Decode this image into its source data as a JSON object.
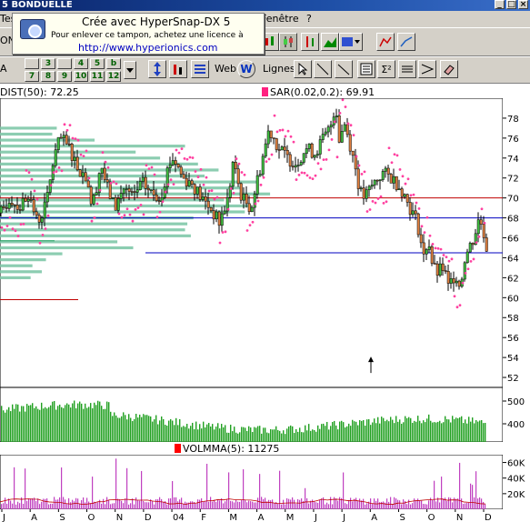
{
  "window": {
    "title": "5 BONDUELLE"
  },
  "menu": {
    "left_fragment": "Tes",
    "window_menu": "Fenêtre",
    "help_menu": "?"
  },
  "toolbar": {
    "left_fragment1": "ON",
    "left_fragment2": "A",
    "numbers_row1": [
      "3",
      "4",
      "5",
      "6"
    ],
    "numbers_row2": [
      "7",
      "8",
      "9",
      "10",
      "11",
      "12"
    ],
    "letters": [
      "a",
      "b"
    ],
    "web_label": "Web",
    "lines_label": "Lignes"
  },
  "stamp": {
    "line1": "Crée avec HyperSnap-DX 5",
    "line2": "Pour enlever ce tampon, achetez une licence à",
    "line3": "http://www.hyperionics.com"
  },
  "indicators": {
    "dist": "DIST(50): 72.25",
    "sar": "SAR(0.02,0.2): 69.91",
    "volmma": "VOLMMA(5): 11275",
    "dist_color": "#ff0000",
    "sar_color": "#ff2080"
  },
  "chart_data": [
    {
      "type": "candlestick",
      "ylim": [
        51,
        80
      ],
      "yticks": [
        "52",
        "54",
        "56",
        "58",
        "60",
        "62",
        "64",
        "66",
        "68",
        "70",
        "72",
        "74",
        "76",
        "78"
      ],
      "xlabels": [
        "J",
        "A",
        "S",
        "O",
        "N",
        "D",
        "04",
        "F",
        "M",
        "A",
        "M",
        "J",
        "J",
        "A",
        "S",
        "O",
        "N",
        "D"
      ],
      "price_path": [
        [
          0,
          68.5
        ],
        [
          10,
          70.0
        ],
        [
          20,
          69.0
        ],
        [
          30,
          70.5
        ],
        [
          40,
          67.5
        ],
        [
          50,
          69.5
        ],
        [
          58,
          74.0
        ],
        [
          65,
          76.0
        ],
        [
          75,
          75.0
        ],
        [
          85,
          73.0
        ],
        [
          95,
          72.0
        ],
        [
          100,
          69.0
        ],
        [
          110,
          73.5
        ],
        [
          115,
          71.5
        ],
        [
          125,
          69.0
        ],
        [
          135,
          71.0
        ],
        [
          145,
          70.0
        ],
        [
          155,
          71.5
        ],
        [
          165,
          70.5
        ],
        [
          175,
          70.0
        ],
        [
          185,
          73.5
        ],
        [
          190,
          74.0
        ],
        [
          200,
          72.0
        ],
        [
          210,
          71.5
        ],
        [
          220,
          70.0
        ],
        [
          230,
          69.0
        ],
        [
          240,
          67.5
        ],
        [
          250,
          70.0
        ],
        [
          255,
          73.5
        ],
        [
          265,
          70.0
        ],
        [
          275,
          69.0
        ],
        [
          285,
          73.0
        ],
        [
          295,
          77.0
        ],
        [
          305,
          75.0
        ],
        [
          315,
          74.0
        ],
        [
          325,
          73.5
        ],
        [
          335,
          75.0
        ],
        [
          345,
          74.5
        ],
        [
          355,
          76.0
        ],
        [
          362,
          77.0
        ],
        [
          368,
          79.5
        ],
        [
          372,
          76.0
        ],
        [
          378,
          77.5
        ],
        [
          385,
          75.0
        ],
        [
          390,
          73.0
        ],
        [
          395,
          70.5
        ],
        [
          400,
          70.0
        ],
        [
          410,
          71.5
        ],
        [
          420,
          72.5
        ],
        [
          430,
          72.0
        ],
        [
          440,
          71.0
        ],
        [
          450,
          69.0
        ],
        [
          458,
          67.5
        ],
        [
          465,
          64.0
        ],
        [
          470,
          66.0
        ],
        [
          475,
          63.0
        ],
        [
          480,
          62.5
        ],
        [
          487,
          63.0
        ],
        [
          492,
          61.0
        ],
        [
          500,
          62.5
        ],
        [
          505,
          61.0
        ],
        [
          510,
          64.0
        ],
        [
          515,
          65.0
        ],
        [
          520,
          66.0
        ],
        [
          526,
          68.0
        ],
        [
          530,
          67.0
        ],
        [
          534,
          65.0
        ]
      ],
      "annotation_arrow": {
        "x": 408,
        "y_value": 53
      },
      "reference_lines": [
        {
          "value": 70.0,
          "color": "#c00000"
        },
        {
          "value": 68.0,
          "color": "#0000c0"
        },
        {
          "value": 64.5,
          "color": "#0000c0"
        }
      ]
    },
    {
      "type": "bar",
      "title": "Volume",
      "yticks": [
        "500",
        "400"
      ],
      "ylim": [
        320,
        560
      ]
    },
    {
      "type": "bar",
      "title": "VOLMMA(5): 11275",
      "yticks": [
        "60K",
        "40K",
        "20K"
      ],
      "ylim": [
        0,
        70000
      ]
    }
  ],
  "colors": {
    "candle_up": "#40c040",
    "candle_down": "#e08040",
    "sar_dots": "#ff40a0",
    "volume_bar": "#20a020",
    "volmma_bar": "#c040c0",
    "histogram": "#7fc8a8"
  },
  "icons": [
    "camera-icon",
    "candlestick-icon",
    "bar-chart-icon",
    "mountain-chart-icon",
    "web-globe-icon",
    "cursor-icon",
    "line-tool-icon",
    "fibonacci-icon",
    "eraser-icon"
  ]
}
